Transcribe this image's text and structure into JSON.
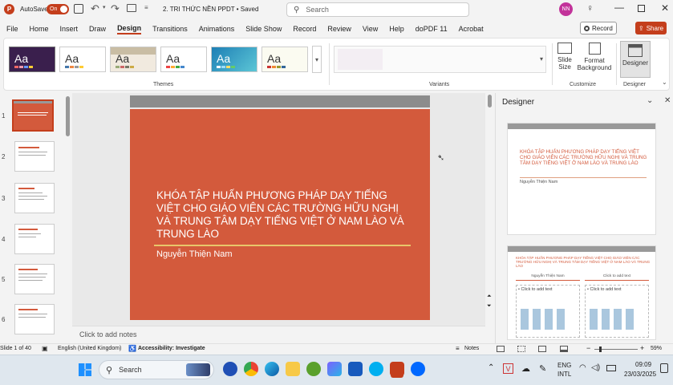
{
  "titlebar": {
    "autosave_label": "AutoSave",
    "autosave_state": "On",
    "doc_title": "2. TRI THỨC NỀN PPDT • Saved",
    "search_placeholder": "Search",
    "avatar_initials": "NN"
  },
  "menu": {
    "tabs": [
      "File",
      "Home",
      "Insert",
      "Draw",
      "Design",
      "Transitions",
      "Animations",
      "Slide Show",
      "Record",
      "Review",
      "View",
      "Help",
      "doPDF 11",
      "Acrobat"
    ],
    "active_tab": "Design",
    "record_label": "Record",
    "share_label": "Share"
  },
  "ribbon": {
    "themes_label": "Themes",
    "variants_label": "Variants",
    "customize_label": "Customize",
    "designer_group_label": "Designer",
    "theme_sample_text": "Aa",
    "slide_size_label": "Slide Size",
    "format_bg_label": "Format Background",
    "designer_btn_label": "Designer"
  },
  "slides_panel": {
    "numbers": [
      "1",
      "2",
      "3",
      "4",
      "5",
      "6"
    ]
  },
  "slide": {
    "title": "KHÓA TẬP HUẤN PHƯƠNG PHÁP DẠY TIẾNG VIỆT CHO GIÁO VIÊN CÁC TRƯỜNG HỮU NGHỊ VÀ TRUNG TÂM DẠY TIẾNG VIỆT Ở NAM LÀO VÀ TRUNG LÀO",
    "subtitle": "Nguyễn Thiện Nam",
    "bg_color": "#d35a3c"
  },
  "notes": {
    "placeholder": "Click to add notes"
  },
  "designer": {
    "title": "Designer",
    "card1_title": "KHÓA TẬP HUẤN PHƯƠNG PHÁP DẠY TIẾNG VIỆT CHO GIÁO VIÊN CÁC TRƯỜNG HỮU NGHỊ VÀ TRUNG TÂM DẠY TIẾNG VIỆT Ở NAM LÀO VÀ TRUNG LÀO",
    "card1_sub": "Nguyễn Thiện Nam",
    "card2_title": "KHÓA TẬP HUẤN PHƯƠNG PHÁP DẠY TIẾNG VIỆT CHO GIÁO VIÊN CÁC TRƯỜNG HỮU NGHỊ VÀ TRUNG TÂM DẠY TIẾNG VIỆT Ở NAM LÀO VÀ TRUNG LÀO",
    "card2_left_head": "Nguyễn Thiện Nam",
    "card2_right_head": "Click to add text",
    "card2_left_body": "• Click to add text",
    "card2_right_body": "• Click to add text"
  },
  "status": {
    "slide_of": "Slide 1 of 40",
    "language": "English (United Kingdom)",
    "accessibility": "Accessibility: Investigate",
    "notes_btn": "Notes",
    "zoom": "59%"
  },
  "taskbar": {
    "search_placeholder": "Search",
    "lang1": "ENG",
    "lang2": "INTL",
    "time": "09:09",
    "date": "23/03/2025"
  },
  "colors": {
    "accent": "#c43e1c",
    "slide_red": "#d35a3c",
    "gold_line": "#e8c66a"
  }
}
